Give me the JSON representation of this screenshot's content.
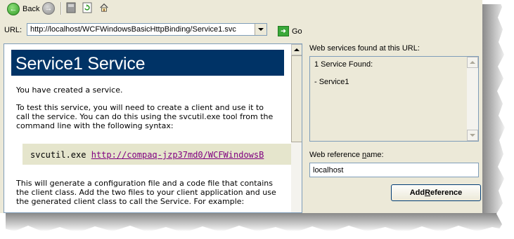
{
  "toolbar": {
    "back_label": "Back",
    "icons": [
      "back-arrow-icon",
      "forward-arrow-icon",
      "stop-icon",
      "refresh-icon",
      "home-icon"
    ]
  },
  "url_bar": {
    "label": "URL:",
    "value": "http://localhost/WCFWindowsBasicHttpBinding/Service1.svc",
    "go_label": "Go"
  },
  "browser": {
    "heading": "Service1 Service",
    "paragraph1": "You have created a service.",
    "paragraph2_lines": [
      "To test this service, you will need to create a client and use it to",
      "call the service. You can do this using the svcutil.exe tool from the",
      "command line with the following syntax:"
    ],
    "code_command": "svcutil.exe",
    "code_link": "http://compaq-jzp37md0/WCFWindowsB",
    "paragraph3_lines": [
      "This will generate a configuration file and a code file that contains",
      "the client class. Add the two files to your client application and use",
      "the generated client class to call the Service. For example:"
    ]
  },
  "right_panel": {
    "found_label": "Web services found at this URL:",
    "found_count": "1 Service Found:",
    "found_item": "- Service1",
    "ref_label_pre": "Web reference ",
    "ref_label_hot": "n",
    "ref_label_post": "ame:",
    "ref_value": "localhost",
    "add_pre": "Add ",
    "add_hot": "R",
    "add_post": "eference"
  },
  "colors": {
    "heading_bar": "#003366",
    "code_box": "#e5e5cc",
    "link": "#800080",
    "window_bg": "#ece9d8"
  }
}
